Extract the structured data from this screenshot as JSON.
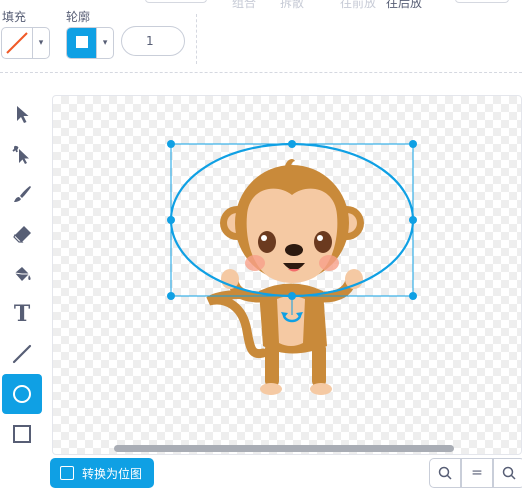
{
  "header": {
    "fragments": [
      "组合",
      "拆散",
      "往前放",
      "往后放"
    ],
    "fill_label": "填充",
    "outline_label": "轮廓",
    "outline_width": "1",
    "dropdown_arrow": "▾"
  },
  "colors": {
    "accent": "#0fa0e4",
    "fill_slash": "#f05a28",
    "selection": "#0fa0e4"
  },
  "tools": [
    {
      "name": "select-tool",
      "icon": "arrow-icon"
    },
    {
      "name": "reshape-tool",
      "icon": "reshape-icon"
    },
    {
      "name": "brush-tool",
      "icon": "brush-icon"
    },
    {
      "name": "eraser-tool",
      "icon": "eraser-icon"
    },
    {
      "name": "fill-tool",
      "icon": "bucket-icon"
    },
    {
      "name": "text-tool",
      "icon": "text-icon",
      "glyph": "T"
    },
    {
      "name": "line-tool",
      "icon": "line-icon"
    },
    {
      "name": "circle-tool",
      "icon": "circle-icon",
      "active": true
    },
    {
      "name": "rectangle-tool",
      "icon": "rectangle-icon"
    }
  ],
  "footer": {
    "convert_label": "转换为位图",
    "zoom_out": "−",
    "zoom_reset": "="
  }
}
